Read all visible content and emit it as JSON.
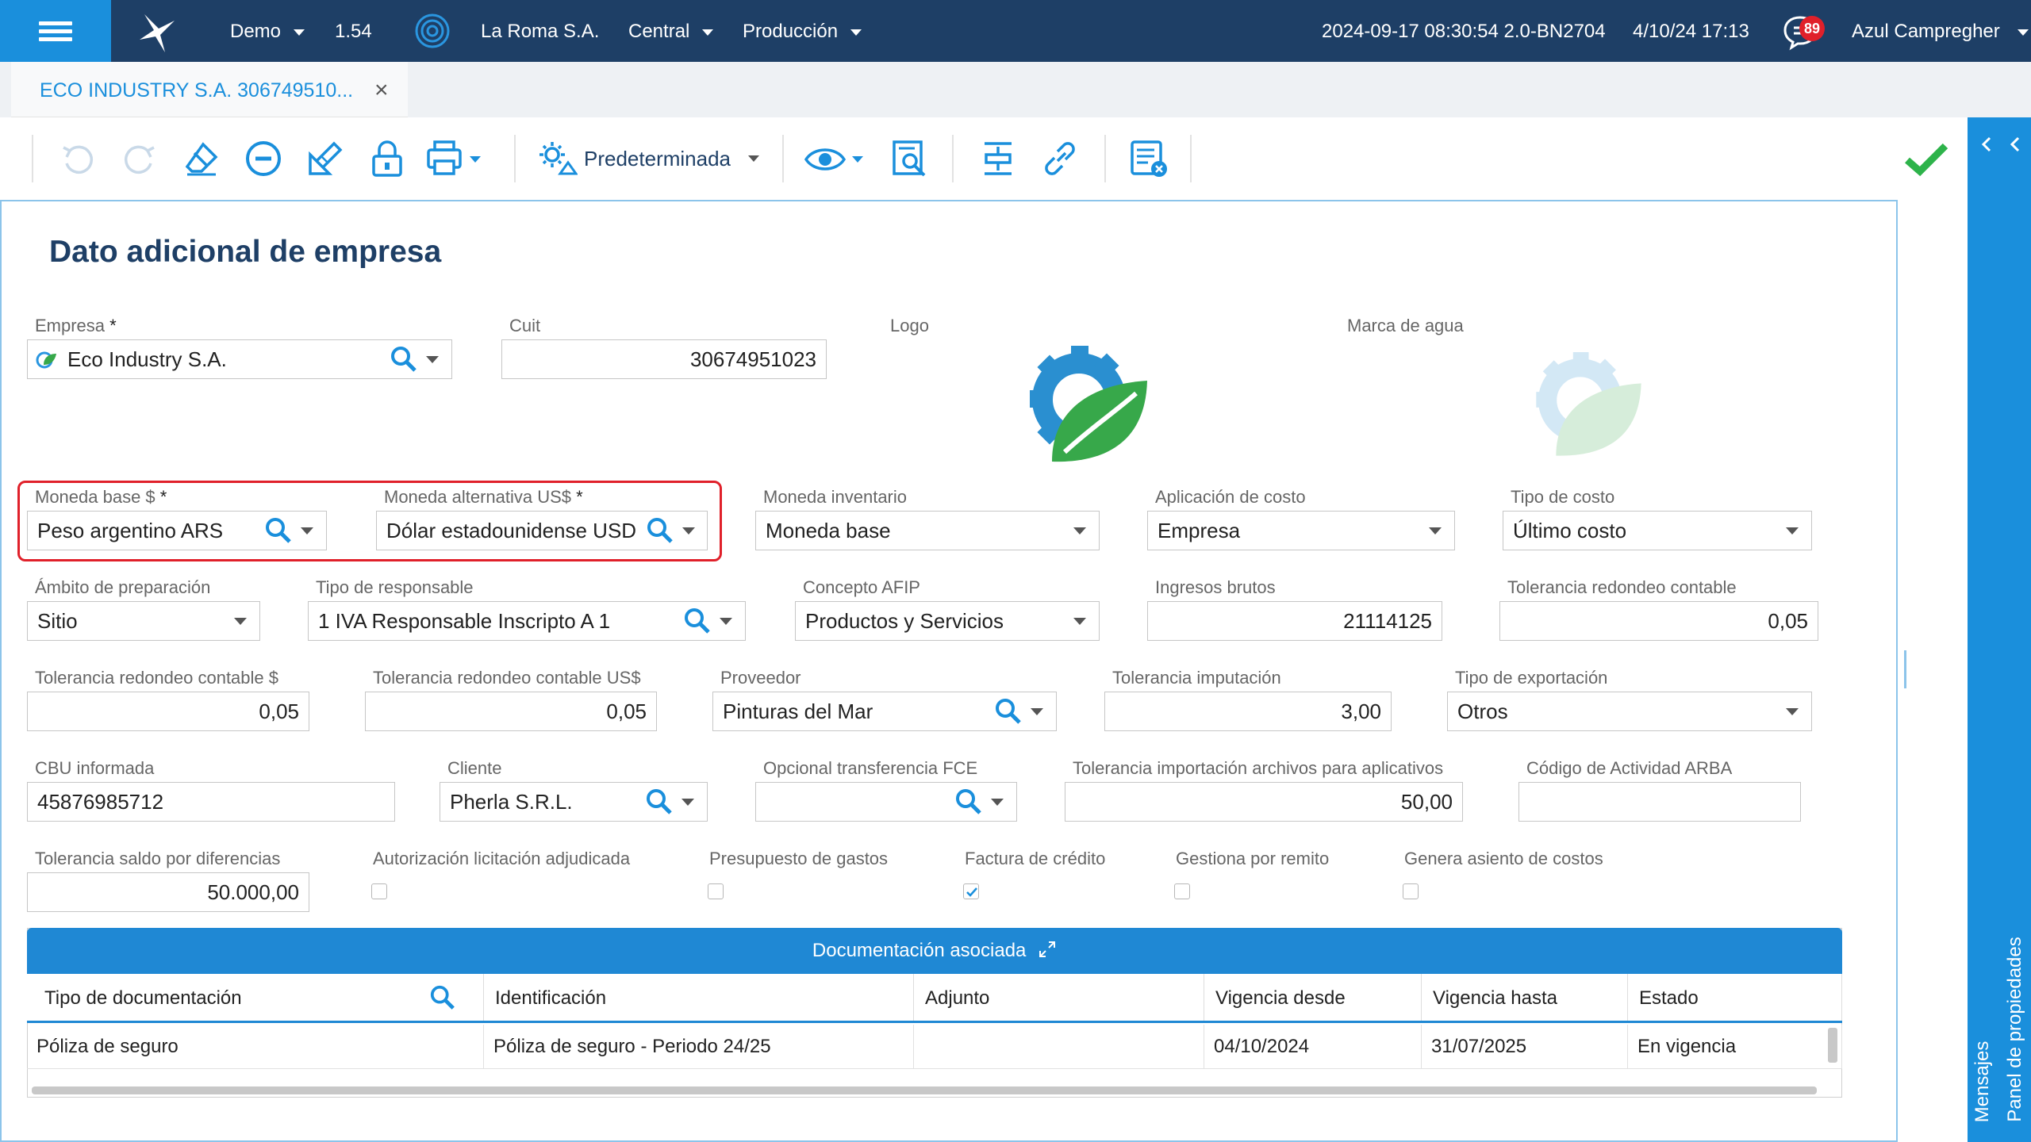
{
  "topbar": {
    "env": "Demo",
    "version": "1.54",
    "company": "La Roma S.A.",
    "branch": "Central",
    "mode": "Producción",
    "build": "2024-09-17 08:30:54 2.0-BN2704",
    "datetime": "4/10/24 17:13",
    "notifications": "89",
    "user": "Azul Campregher"
  },
  "tab": {
    "title": "ECO INDUSTRY S.A. 306749510...",
    "close": "×"
  },
  "toolbar": {
    "view_label": "Predeterminada"
  },
  "form": {
    "title": "Dato adicional de empresa",
    "empresa_label": "Empresa",
    "empresa_value": "Eco Industry S.A.",
    "cuit_label": "Cuit",
    "cuit_value": "30674951023",
    "logo_label": "Logo",
    "watermark_label": "Marca de agua",
    "moneda_base_label": "Moneda base $",
    "moneda_base_value": "Peso argentino ARS",
    "moneda_alt_label": "Moneda alternativa US$",
    "moneda_alt_value": "Dólar estadounidense USD",
    "moneda_inv_label": "Moneda inventario",
    "moneda_inv_value": "Moneda base",
    "aplic_costo_label": "Aplicación de costo",
    "aplic_costo_value": "Empresa",
    "tipo_costo_label": "Tipo de costo",
    "tipo_costo_value": "Último costo",
    "ambito_label": "Ámbito de preparación",
    "ambito_value": "Sitio",
    "tipo_resp_label": "Tipo de responsable",
    "tipo_resp_value": "1 IVA Responsable Inscripto A 1",
    "concepto_label": "Concepto AFIP",
    "concepto_value": "Productos y Servicios",
    "ingresos_label": "Ingresos brutos",
    "ingresos_value": "21114125",
    "tol_red_label": "Tolerancia redondeo contable",
    "tol_red_value": "0,05",
    "tol_red_ars_label": "Tolerancia redondeo contable $",
    "tol_red_ars_value": "0,05",
    "tol_red_usd_label": "Tolerancia redondeo contable US$",
    "tol_red_usd_value": "0,05",
    "proveedor_label": "Proveedor",
    "proveedor_value": "Pinturas del Mar",
    "tol_imp_label": "Tolerancia imputación",
    "tol_imp_value": "3,00",
    "tipo_exp_label": "Tipo de exportación",
    "tipo_exp_value": "Otros",
    "cbu_label": "CBU informada",
    "cbu_value": "45876985712",
    "cliente_label": "Cliente",
    "cliente_value": "Pherla S.R.L.",
    "opc_fce_label": "Opcional transferencia FCE",
    "opc_fce_value": "",
    "tol_archivos_label": "Tolerancia importación archivos para aplicativos",
    "tol_archivos_value": "50,00",
    "cod_arba_label": "Código de Actividad ARBA",
    "cod_arba_value": "",
    "tol_saldo_label": "Tolerancia saldo por diferencias",
    "tol_saldo_value": "50.000,00",
    "autoriz_label": "Autorización licitación adjudicada",
    "presup_label": "Presupuesto de gastos",
    "factura_label": "Factura de crédito",
    "gestiona_label": "Gestiona por remito",
    "genera_label": "Genera asiento de costos",
    "required_mark": "*"
  },
  "checkboxes": {
    "autoriz": false,
    "presup": false,
    "factura": true,
    "gestiona": false,
    "genera": false
  },
  "grid": {
    "title": "Documentación asociada",
    "columns": [
      "Tipo de documentación",
      "Identificación",
      "Adjunto",
      "Vigencia desde",
      "Vigencia hasta",
      "Estado"
    ],
    "rows": [
      [
        "Póliza de seguro",
        "Póliza de seguro - Periodo 24/25",
        "",
        "04/10/2024",
        "31/07/2025",
        "En vigencia"
      ]
    ]
  },
  "side_panel": {
    "messages": "Mensajes",
    "properties": "Panel de propiedades"
  },
  "colors": {
    "topbar": "#1e3f66",
    "accent": "#1a8fdc",
    "title": "#1e3f66",
    "highlight": "#e0202a",
    "success": "#2db34a"
  }
}
